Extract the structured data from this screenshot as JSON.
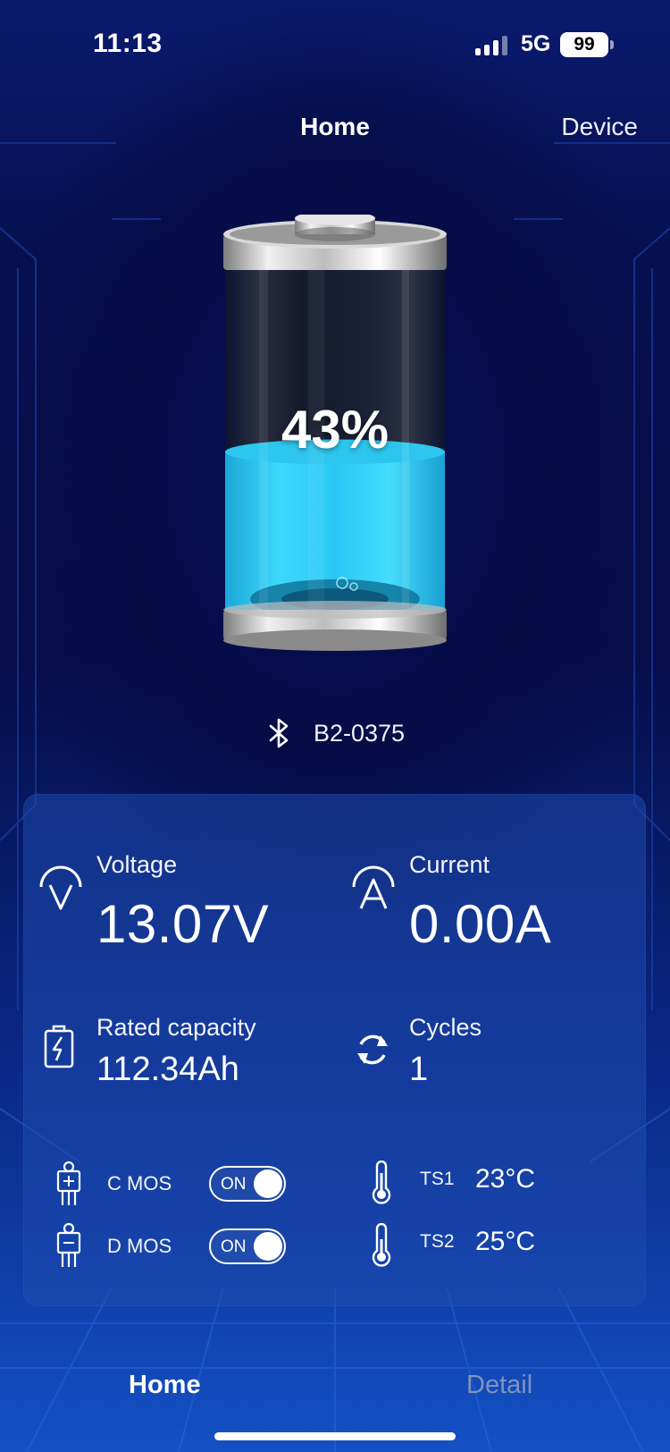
{
  "status_bar": {
    "time": "11:13",
    "network": "5G",
    "battery_level": "99"
  },
  "nav": {
    "title": "Home",
    "device_label": "Device"
  },
  "battery": {
    "soc_text": "43%",
    "soc_fraction": 0.43,
    "fill_color": "#29c8f5"
  },
  "device": {
    "bluetooth_icon": "bluetooth-icon",
    "name": "B2-0375"
  },
  "metrics": {
    "voltage": {
      "label": "Voltage",
      "value": "13.07V",
      "icon": "voltage-gauge-icon"
    },
    "current": {
      "label": "Current",
      "value": "0.00A",
      "icon": "current-gauge-icon"
    },
    "rated_capacity": {
      "label": "Rated capacity",
      "value": "112.34Ah",
      "icon": "battery-charge-icon"
    },
    "cycles": {
      "label": "Cycles",
      "value": "1",
      "icon": "refresh-cycle-icon"
    }
  },
  "switches": {
    "c_mos": {
      "label": "C MOS",
      "state": "ON",
      "icon": "mosfet-icon"
    },
    "d_mos": {
      "label": "D MOS",
      "state": "ON",
      "icon": "mosfet-icon"
    }
  },
  "temperatures": {
    "ts1": {
      "label": "TS1",
      "value": "23°C",
      "icon": "thermometer-icon"
    },
    "ts2": {
      "label": "TS2",
      "value": "25°C",
      "icon": "thermometer-icon"
    }
  },
  "tabs": {
    "home": "Home",
    "detail": "Detail"
  },
  "colors": {
    "background": "#060d48",
    "panel": "#1e4baf",
    "accent": "#29c8f5",
    "inactive_tab": "#7f93bf"
  }
}
